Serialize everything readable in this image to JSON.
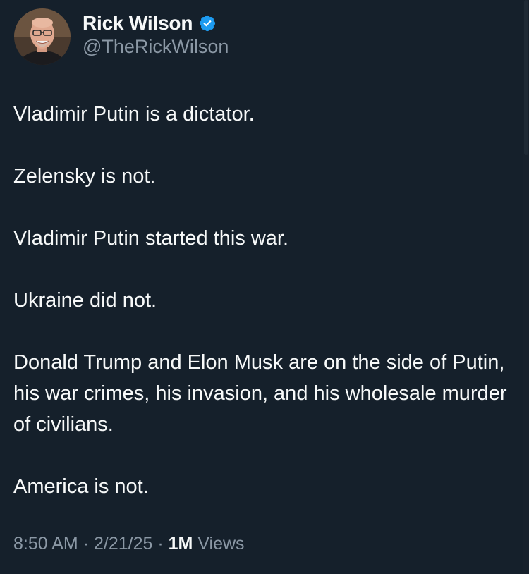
{
  "author": {
    "display_name": "Rick Wilson",
    "handle": "@TheRickWilson",
    "verified": true,
    "verified_icon": "verified-badge-icon",
    "verified_color": "#1d9bf0"
  },
  "tweet": {
    "paragraphs": [
      "Vladimir Putin is a dictator.",
      "Zelensky is not.",
      "Vladimir Putin started this war.",
      "Ukraine did not.",
      "Donald Trump and Elon Musk are on the side of Putin, his war crimes, his invasion, and his wholesale murder of civilians.",
      "America is not."
    ]
  },
  "meta": {
    "time": "8:50 AM",
    "separator": "·",
    "date": "2/21/25",
    "views_count": "1M",
    "views_label": "Views"
  },
  "theme": {
    "background": "#15202b",
    "text": "#f7f9f9",
    "secondary_text": "#8b98a5"
  }
}
